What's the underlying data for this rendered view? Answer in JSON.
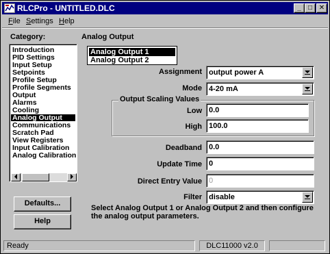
{
  "window": {
    "title": "RLCPro - UNTITLED.DLC",
    "minimize_glyph": "_",
    "maximize_glyph": "□",
    "close_glyph": "✕"
  },
  "menu": {
    "items": [
      {
        "accel": "F",
        "rest": "ile"
      },
      {
        "accel": "S",
        "rest": "ettings"
      },
      {
        "accel": "H",
        "rest": "elp"
      }
    ]
  },
  "category": {
    "label": "Category:",
    "items": [
      "Introduction",
      "PID Settings",
      "Input Setup",
      "Setpoints",
      "Profile Setup",
      "Profile Segments",
      "Output",
      "Alarms",
      "Cooling",
      "Analog Output",
      "Communications",
      "Scratch Pad",
      "View Registers",
      "Input Calibration",
      "Analog Calibration"
    ],
    "selected": "Analog Output"
  },
  "buttons": {
    "defaults": "Defaults...",
    "help": "Help"
  },
  "panel": {
    "title": "Analog Output",
    "outputs": [
      "Analog Output 1",
      "Analog Output 2"
    ],
    "selected_output": "Analog Output 1",
    "assignment": {
      "label": "Assignment",
      "value": "output power A"
    },
    "mode": {
      "label": "Mode",
      "value": "4-20 mA"
    },
    "scaling": {
      "title": "Output Scaling Values",
      "low": {
        "label": "Low",
        "value": "0.0"
      },
      "high": {
        "label": "High",
        "value": "100.0"
      }
    },
    "deadband": {
      "label": "Deadband",
      "value": "0.0"
    },
    "update_time": {
      "label": "Update Time",
      "value": "0"
    },
    "direct_entry": {
      "label": "Direct Entry Value",
      "value": "0"
    },
    "filter": {
      "label": "Filter",
      "value": "disable"
    },
    "help_text": "Select Analog Output 1 or Analog Output 2 and then configure the analog output parameters."
  },
  "status": {
    "left": "Ready",
    "middle": "DLC11000 v2.0",
    "right": ""
  }
}
